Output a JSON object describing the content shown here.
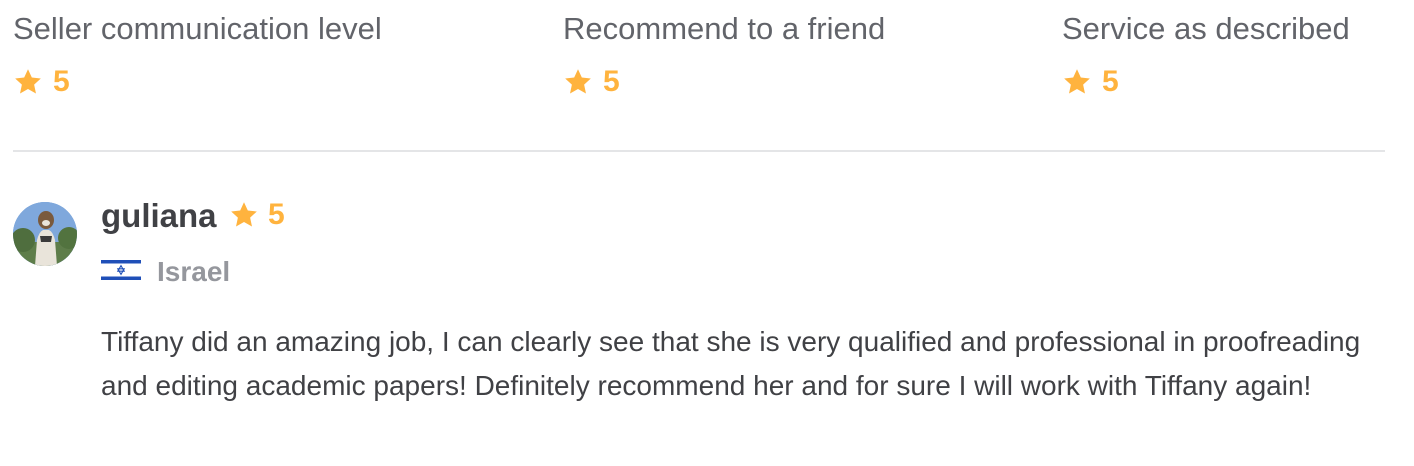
{
  "ratings": [
    {
      "label": "Seller communication level",
      "score": "5",
      "icon": "star-icon"
    },
    {
      "label": "Recommend to a friend",
      "score": "5",
      "icon": "star-icon"
    },
    {
      "label": "Service as described",
      "score": "5",
      "icon": "star-icon"
    }
  ],
  "review": {
    "username": "guliana",
    "score": "5",
    "country": "Israel",
    "flag_icon": "israel-flag-icon",
    "text": "Tiffany did an amazing job, I can clearly see that she is very qualified and professional in proofreading and editing academic papers! Definitely recommend her and for sure I will work with Tiffany again!"
  },
  "colors": {
    "star": "#ffb33e",
    "label": "#62646a",
    "text": "#404145",
    "muted": "#95979d",
    "divider": "#e4e5e7"
  }
}
